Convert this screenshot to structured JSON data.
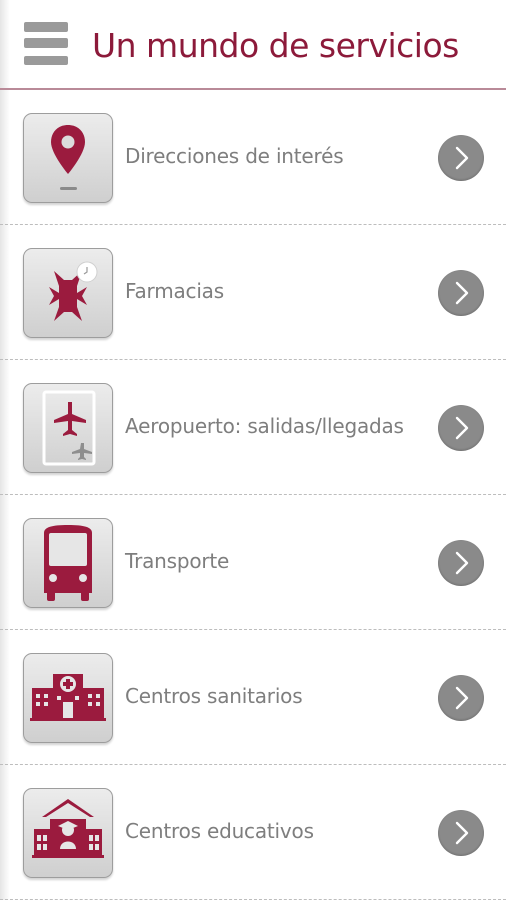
{
  "colors": {
    "brand": "#8c1a3a",
    "icon_fill": "#9b1b3e",
    "menu_icon": "#9a9a9a",
    "label_gray": "#7e7e7e",
    "chevron_bg": "#8a8a8a"
  },
  "header": {
    "title": "Un mundo de servicios",
    "menu_icon": "hamburger-menu-icon"
  },
  "items": [
    {
      "label": "Direcciones de interés",
      "icon": "map-pin-icon",
      "action_icon": "chevron-right-icon"
    },
    {
      "label": "Farmacias",
      "icon": "pharmacy-cross-icon",
      "action_icon": "chevron-right-icon"
    },
    {
      "label": "Aeropuerto: salidas/llegadas",
      "icon": "airport-plane-icon",
      "action_icon": "chevron-right-icon"
    },
    {
      "label": "Transporte",
      "icon": "bus-icon",
      "action_icon": "chevron-right-icon"
    },
    {
      "label": "Centros sanitarios",
      "icon": "hospital-icon",
      "action_icon": "chevron-right-icon"
    },
    {
      "label": "Centros educativos",
      "icon": "school-icon",
      "action_icon": "chevron-right-icon"
    }
  ]
}
